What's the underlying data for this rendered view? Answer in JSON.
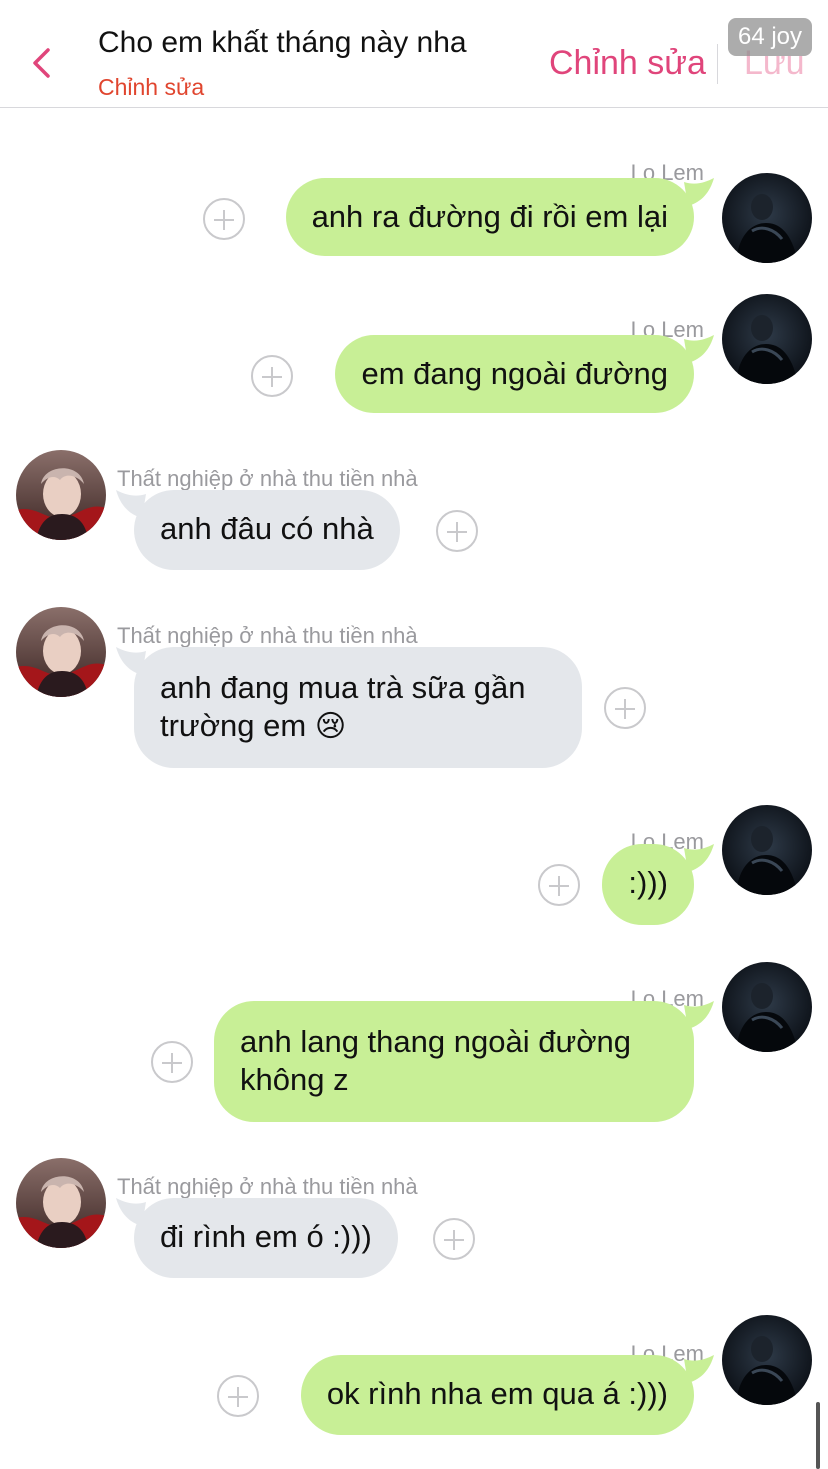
{
  "header": {
    "title": "Cho em khất tháng này nha",
    "subtitle": "Chỉnh sửa",
    "edit_label": "Chỉnh sửa",
    "save_label": "Lưu"
  },
  "badge": "64 joy",
  "contacts": {
    "me": "Lọ Lem",
    "other": "Thất nghiệp ở nhà thu tiền nhà"
  },
  "messages": [
    {
      "side": "right",
      "sender": "Lọ Lem",
      "text": "anh ra đường đi rồi em lại"
    },
    {
      "side": "right",
      "sender": "Lọ Lem",
      "text": "em đang ngoài đường"
    },
    {
      "side": "left",
      "sender": "Thất nghiệp ở nhà thu tiền nhà",
      "text": "anh đâu có nhà"
    },
    {
      "side": "left",
      "sender": "Thất nghiệp ở nhà thu tiền nhà",
      "line1": "anh đang mua trà sữa gần",
      "line2": "trường em",
      "emoji": "😢"
    },
    {
      "side": "right",
      "sender": "Lọ Lem",
      "text": ":)))"
    },
    {
      "side": "right",
      "sender": "Lọ Lem",
      "line1": "anh lang thang ngoài đường",
      "line2": "không z"
    },
    {
      "side": "left",
      "sender": "Thất nghiệp ở nhà thu tiền nhà",
      "text": "đi rình em ó :)))"
    },
    {
      "side": "right",
      "sender": "Lọ Lem",
      "text": "ok rình nha em qua á :)))"
    }
  ],
  "colors": {
    "accent": "#e0457b",
    "subtitle": "#e0452e",
    "bubble_me": "#c8ef96",
    "bubble_other": "#e4e7eb"
  },
  "icons": {
    "back": "chevron-left-icon",
    "add_reaction": "plus-circle-icon"
  }
}
